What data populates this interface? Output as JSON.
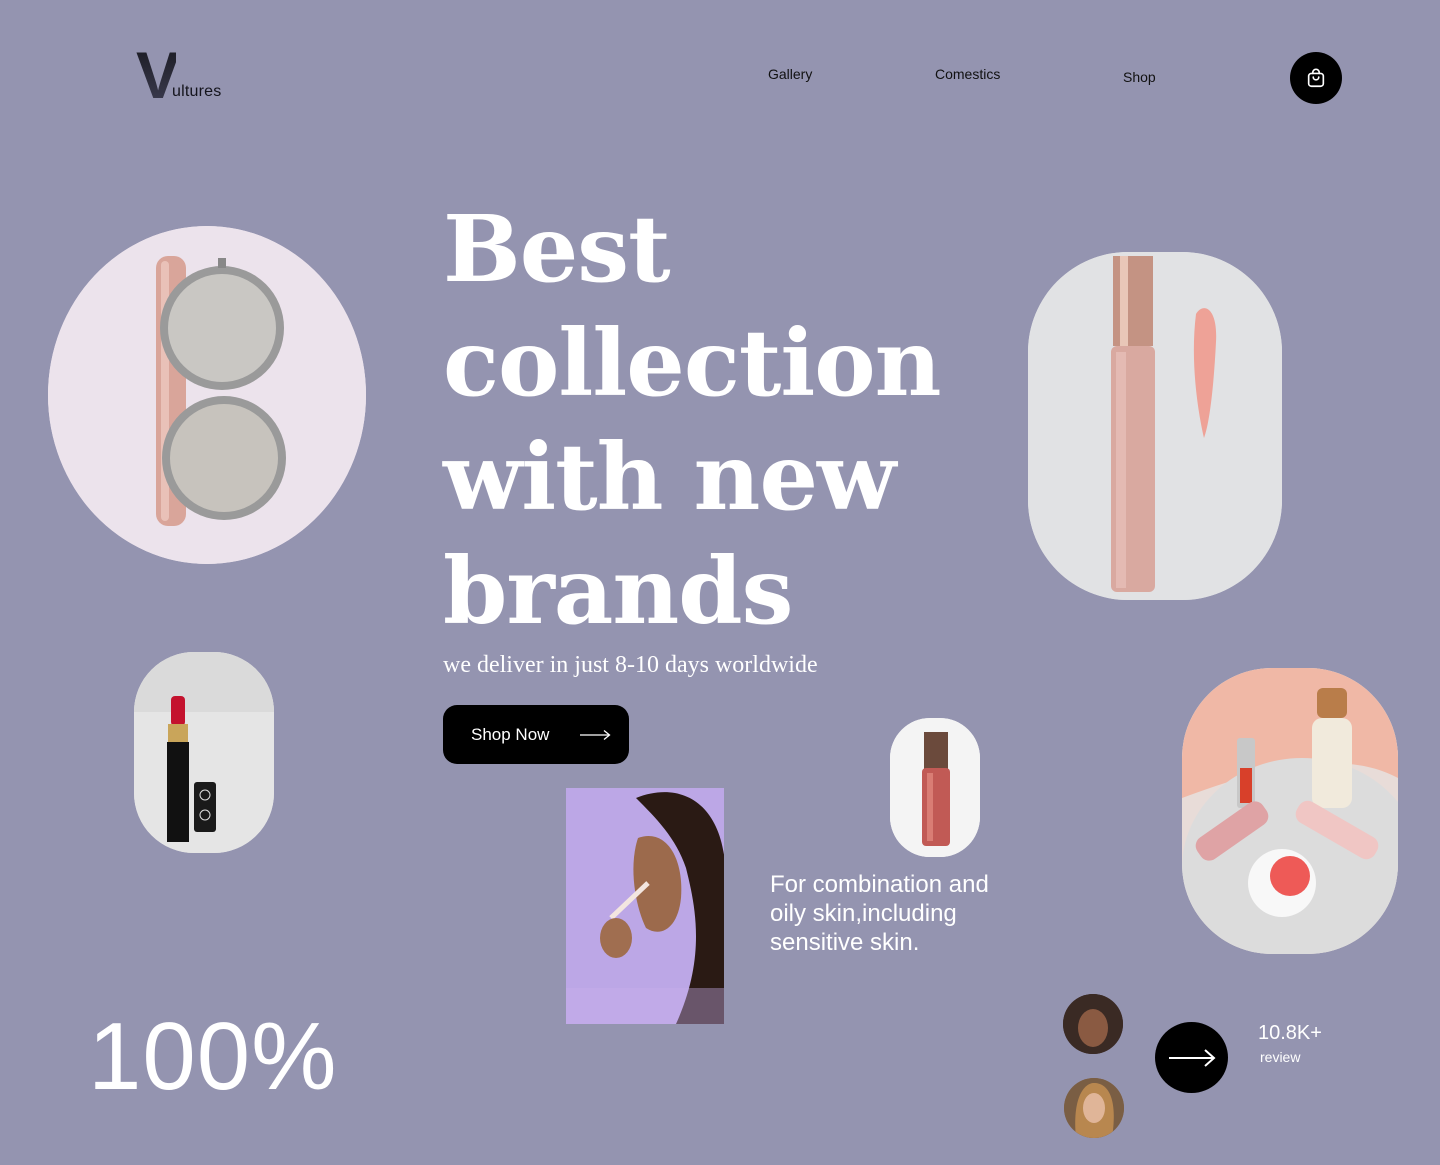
{
  "brand": {
    "initial": "V",
    "rest": "ultures"
  },
  "nav": {
    "items": [
      {
        "label": "Gallery"
      },
      {
        "label": "Comestics"
      },
      {
        "label": "Shop"
      }
    ],
    "cart_icon": "shopping-bag-icon"
  },
  "hero": {
    "title_lines": [
      "Best",
      "collection",
      "with new",
      "brands"
    ],
    "subtitle": "we deliver in just 8-10 days worldwide",
    "cta_label": "Shop Now",
    "cta_icon": "arrow-right-icon"
  },
  "feature": {
    "text": "For combination and oily skin,including sensitive skin."
  },
  "stats": {
    "percent": "100%",
    "reviews_count": "10.8K+",
    "reviews_label": "review",
    "reviews_icon": "arrow-right-icon"
  },
  "colors": {
    "background": "#9494b0",
    "button": "#000000",
    "text_light": "#ffffff",
    "text_dark": "#111111"
  }
}
